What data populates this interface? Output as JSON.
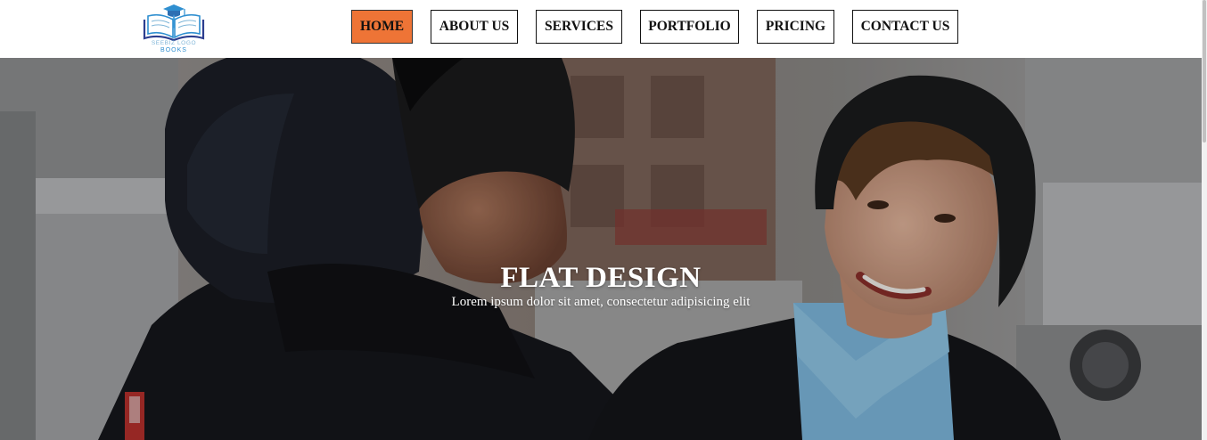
{
  "brand": {
    "logo_line1": "SEEBIZ LOGO",
    "logo_line2": "BOOKS",
    "logo_icon": "open-book-with-graduation-cap-icon",
    "colors": {
      "logo_blue": "#2f8fd0",
      "logo_navy": "#2c3e8f"
    }
  },
  "nav": {
    "items": [
      {
        "label": "HOME",
        "active": true
      },
      {
        "label": "ABOUT US",
        "active": false
      },
      {
        "label": "SERVICES",
        "active": false
      },
      {
        "label": "PORTFOLIO",
        "active": false
      },
      {
        "label": "PRICING",
        "active": false
      },
      {
        "label": "CONTACT US",
        "active": false
      }
    ],
    "colors": {
      "active_bg": "#ee7436",
      "border": "#111111"
    }
  },
  "hero": {
    "title": "FLAT DESIGN",
    "subtitle": "Lorem ipsum dolor sit amet, consectetur adipisicing elit",
    "image": "two-young-men-smiling-in-winter-jackets-photo"
  }
}
